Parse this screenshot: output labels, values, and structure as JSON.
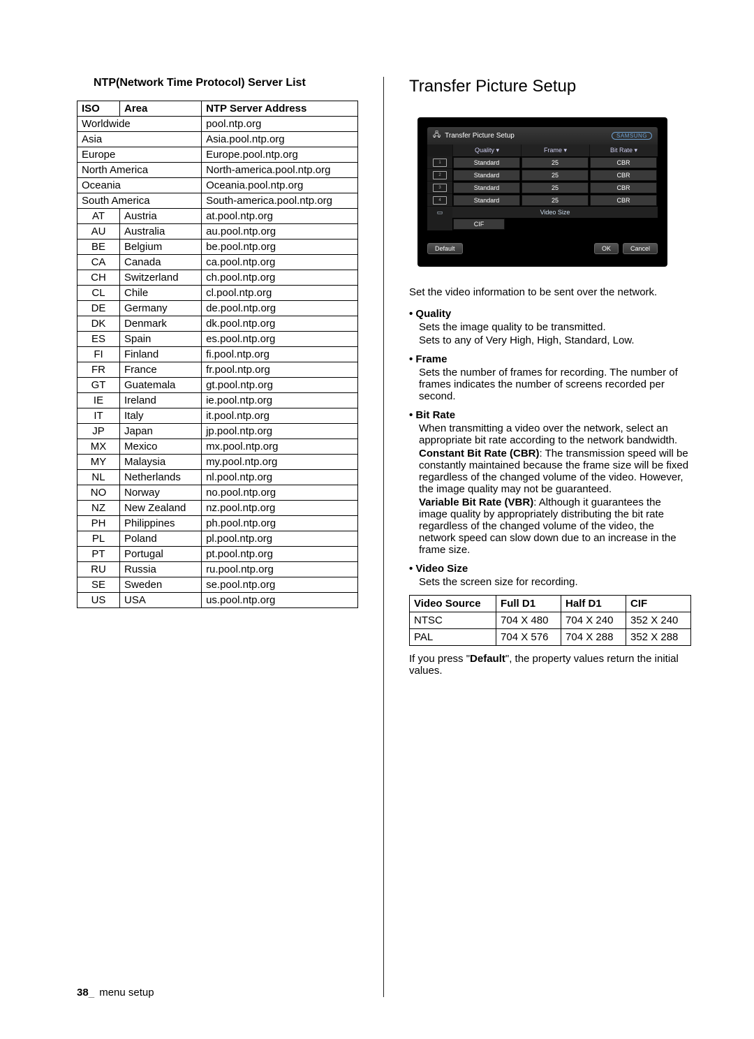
{
  "left": {
    "list_title": "NTP(Network Time Protocol) Server List",
    "headers": {
      "iso": "ISO",
      "area": "Area",
      "server": "NTP Server Address"
    },
    "regions": [
      {
        "name": "Worldwide",
        "server": "pool.ntp.org"
      },
      {
        "name": "Asia",
        "server": "Asia.pool.ntp.org"
      },
      {
        "name": "Europe",
        "server": "Europe.pool.ntp.org"
      },
      {
        "name": "North America",
        "server": "North-america.pool.ntp.org"
      },
      {
        "name": "Oceania",
        "server": "Oceania.pool.ntp.org"
      },
      {
        "name": "South America",
        "server": "South-america.pool.ntp.org"
      }
    ],
    "countries": [
      {
        "iso": "AT",
        "area": "Austria",
        "server": "at.pool.ntp.org"
      },
      {
        "iso": "AU",
        "area": "Australia",
        "server": "au.pool.ntp.org"
      },
      {
        "iso": "BE",
        "area": "Belgium",
        "server": "be.pool.ntp.org"
      },
      {
        "iso": "CA",
        "area": "Canada",
        "server": "ca.pool.ntp.org"
      },
      {
        "iso": "CH",
        "area": "Switzerland",
        "server": "ch.pool.ntp.org"
      },
      {
        "iso": "CL",
        "area": "Chile",
        "server": "cl.pool.ntp.org"
      },
      {
        "iso": "DE",
        "area": "Germany",
        "server": "de.pool.ntp.org"
      },
      {
        "iso": "DK",
        "area": "Denmark",
        "server": "dk.pool.ntp.org"
      },
      {
        "iso": "ES",
        "area": "Spain",
        "server": "es.pool.ntp.org"
      },
      {
        "iso": "FI",
        "area": "Finland",
        "server": "fi.pool.ntp.org"
      },
      {
        "iso": "FR",
        "area": "France",
        "server": "fr.pool.ntp.org"
      },
      {
        "iso": "GT",
        "area": "Guatemala",
        "server": "gt.pool.ntp.org"
      },
      {
        "iso": "IE",
        "area": "Ireland",
        "server": "ie.pool.ntp.org"
      },
      {
        "iso": "IT",
        "area": "Italy",
        "server": "it.pool.ntp.org"
      },
      {
        "iso": "JP",
        "area": "Japan",
        "server": "jp.pool.ntp.org"
      },
      {
        "iso": "MX",
        "area": "Mexico",
        "server": "mx.pool.ntp.org"
      },
      {
        "iso": "MY",
        "area": "Malaysia",
        "server": "my.pool.ntp.org"
      },
      {
        "iso": "NL",
        "area": "Netherlands",
        "server": "nl.pool.ntp.org"
      },
      {
        "iso": "NO",
        "area": "Norway",
        "server": "no.pool.ntp.org"
      },
      {
        "iso": "NZ",
        "area": "New Zealand",
        "server": "nz.pool.ntp.org"
      },
      {
        "iso": "PH",
        "area": "Philippines",
        "server": "ph.pool.ntp.org"
      },
      {
        "iso": "PL",
        "area": "Poland",
        "server": "pl.pool.ntp.org"
      },
      {
        "iso": "PT",
        "area": "Portugal",
        "server": "pt.pool.ntp.org"
      },
      {
        "iso": "RU",
        "area": "Russia",
        "server": "ru.pool.ntp.org"
      },
      {
        "iso": "SE",
        "area": "Sweden",
        "server": "se.pool.ntp.org"
      },
      {
        "iso": "US",
        "area": "USA",
        "server": "us.pool.ntp.org"
      }
    ]
  },
  "right": {
    "section_title": "Transfer Picture Setup",
    "device": {
      "window_title": "Transfer Picture Setup",
      "logo": "SAMSUNG",
      "columns": {
        "quality": "Quality",
        "frame": "Frame",
        "bitrate": "Bit Rate"
      },
      "rows": [
        {
          "ch": "1",
          "quality": "Standard",
          "frame": "25",
          "bitrate": "CBR"
        },
        {
          "ch": "2",
          "quality": "Standard",
          "frame": "25",
          "bitrate": "CBR"
        },
        {
          "ch": "3",
          "quality": "Standard",
          "frame": "25",
          "bitrate": "CBR"
        },
        {
          "ch": "4",
          "quality": "Standard",
          "frame": "25",
          "bitrate": "CBR"
        }
      ],
      "video_size_header": "Video Size",
      "cif_value": "CIF",
      "buttons": {
        "default": "Default",
        "ok": "OK",
        "cancel": "Cancel"
      }
    },
    "intro": "Set the video information to be sent over the network.",
    "features": {
      "quality": {
        "title": "Quality",
        "line1": "Sets the image quality to be transmitted.",
        "line2": "Sets to any of Very High, High, Standard, Low."
      },
      "frame": {
        "title": "Frame",
        "body": "Sets the number of frames for recording. The number of frames indicates the number of screens recorded per second."
      },
      "bitrate": {
        "title": "Bit Rate",
        "intro": "When transmitting a video over the network, select an appropriate bit rate according to the network bandwidth.",
        "cbr_label": "Constant Bit Rate (CBR)",
        "cbr_body": ": The transmission speed will be constantly maintained because the frame size will be fixed regardless of the changed volume of the video. However, the image quality may not be guaranteed.",
        "vbr_label": "Variable Bit Rate (VBR)",
        "vbr_body": ": Although it guarantees the image quality by appropriately distributing the bit rate regardless of the changed volume of the video, the network speed can slow down due to an increase in the frame size."
      },
      "videosize": {
        "title": "Video Size",
        "body": "Sets the screen size for recording."
      }
    },
    "vidsize_table": {
      "headers": {
        "src": "Video Source",
        "full": "Full D1",
        "half": "Half D1",
        "cif": "CIF"
      },
      "rows": [
        {
          "src": "NTSC",
          "full": "704 X 480",
          "half": "704 X 240",
          "cif": "352 X 240"
        },
        {
          "src": "PAL",
          "full": "704 X 576",
          "half": "704 X 288",
          "cif": "352 X 288"
        }
      ]
    },
    "default_note_pre": "If you press \"",
    "default_note_bold": "Default",
    "default_note_post": "\", the property values return the initial values."
  },
  "footer": {
    "page_number": "38",
    "sep": "_",
    "label": "menu setup"
  }
}
